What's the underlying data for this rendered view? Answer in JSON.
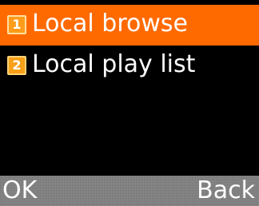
{
  "menu": {
    "items": [
      {
        "number": "1",
        "label": "Local browse",
        "selected": true
      },
      {
        "number": "2",
        "label": "Local play list",
        "selected": false
      }
    ]
  },
  "softkeys": {
    "left_label": "OK",
    "right_label": "Back"
  },
  "colors": {
    "background": "#000000",
    "selection": "#ff6a00",
    "badge": "#f7a018",
    "softkey_bar": "#7f7f7f",
    "text": "#ffffff"
  }
}
